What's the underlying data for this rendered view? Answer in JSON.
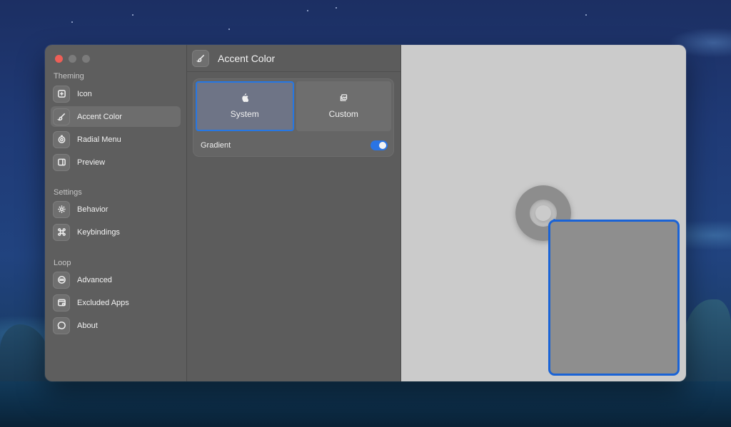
{
  "sidebar": {
    "sections": [
      {
        "title": "Theming"
      },
      {
        "title": "Settings"
      },
      {
        "title": "Loop"
      }
    ],
    "items": [
      {
        "label": "Icon",
        "icon": "app-icon"
      },
      {
        "label": "Accent Color",
        "icon": "paintbrush-icon"
      },
      {
        "label": "Radial Menu",
        "icon": "radial-menu-icon"
      },
      {
        "label": "Preview",
        "icon": "preview-icon"
      },
      {
        "label": "Behavior",
        "icon": "gear-icon"
      },
      {
        "label": "Keybindings",
        "icon": "command-icon"
      },
      {
        "label": "Advanced",
        "icon": "advanced-icon"
      },
      {
        "label": "Excluded Apps",
        "icon": "excluded-apps-icon"
      },
      {
        "label": "About",
        "icon": "about-icon"
      }
    ]
  },
  "main": {
    "title": "Accent Color",
    "segments": [
      {
        "label": "System",
        "icon": "apple-icon",
        "selected": true
      },
      {
        "label": "Custom",
        "icon": "wallpaper-icon",
        "selected": false
      }
    ],
    "gradient": {
      "label": "Gradient",
      "on": true
    }
  },
  "colors": {
    "accent": "#2677e3",
    "preview_border": "#1a63d6"
  }
}
